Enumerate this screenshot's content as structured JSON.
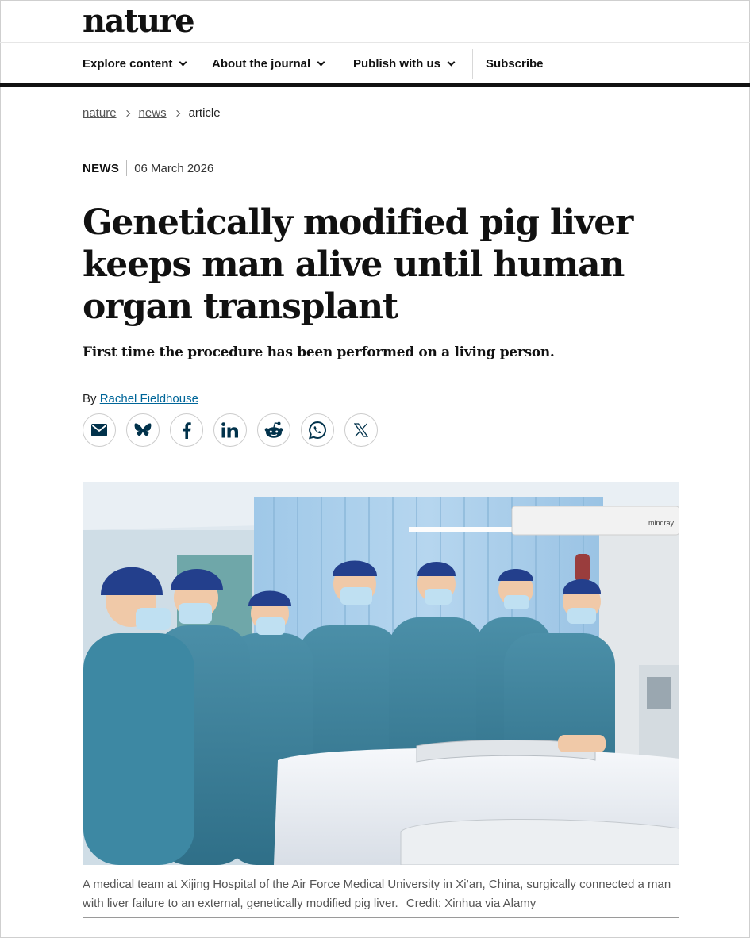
{
  "site": {
    "logo": "nature"
  },
  "nav": {
    "explore": "Explore content",
    "about": "About the journal",
    "publish": "Publish with us",
    "subscribe": "Subscribe"
  },
  "breadcrumb": {
    "home": "nature",
    "section": "news",
    "current": "article"
  },
  "article": {
    "type": "NEWS",
    "date": "06 March 2026",
    "title": "Genetically modified pig liver keeps man alive until human organ transplant",
    "standfirst": "First time the procedure has been performed on a living person.",
    "byline_prefix": "By",
    "author": "Rachel Fieldhouse"
  },
  "share": {
    "icons": [
      "email-icon",
      "bluesky-icon",
      "facebook-icon",
      "linkedin-icon",
      "reddit-icon",
      "whatsapp-icon",
      "x-icon"
    ],
    "icon_color": "#01324b"
  },
  "figure": {
    "photo_brand_text": "mindray",
    "caption": "A medical team at Xijing Hospital of the Air Force Medical University in Xi’an, China, surgically connected a man with liver failure to an external, genetically modified pig liver.",
    "credit": "Credit: Xinhua via Alamy"
  },
  "colors": {
    "link": "#006699",
    "rule": "#111111"
  }
}
